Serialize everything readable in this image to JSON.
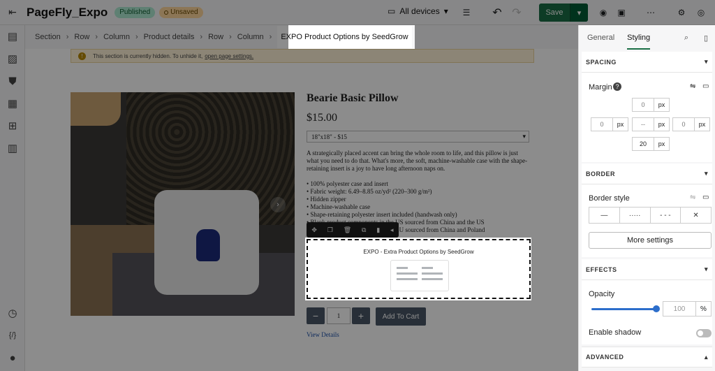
{
  "app": {
    "title": "PageFly_Expo",
    "status_published": "Published",
    "status_unsaved": "Unsaved"
  },
  "toolbar": {
    "devices_label": "All devices",
    "save_label": "Save"
  },
  "breadcrumb": [
    "Section",
    "Row",
    "Column",
    "Product details",
    "Row",
    "Column",
    "EXPO Product Options by SeedGrow"
  ],
  "notice": {
    "text": "This section is currently hidden. To unhide it,",
    "link": "open page settings."
  },
  "product": {
    "title": "Bearie Basic Pillow",
    "price": "$15.00",
    "variant": "18\"x18\" - $15",
    "description": "A strategically placed accent can bring the whole room to life, and this pillow is just what you need to do that. What's more, the soft, machine-washable case with the shape-retaining insert is a joy to have long afternoon naps on.",
    "bullets": [
      "• 100% polyester case and insert",
      "• Fabric weight: 6.49–8.85 oz/yd² (220–300 g/m²)",
      "• Hidden zipper",
      "• Machine-washable case",
      "• Shape-retaining polyester insert included (handwash only)",
      "• Blank product components in the US sourced from China and the US",
      "• Blank product components in the EU sourced from China and Poland"
    ],
    "quantity": "1",
    "add_to_cart": "Add To Cart",
    "view_details": "View Details"
  },
  "expo_block": {
    "title": "EXPO - Extra Product Options by SeedGrow"
  },
  "right_panel": {
    "tab_general": "General",
    "tab_styling": "Styling",
    "spacing": {
      "header": "SPACING",
      "margin_label": "Margin",
      "top": "0",
      "left": "0",
      "center": "--",
      "right": "0",
      "bottom": "20",
      "unit": "px"
    },
    "border": {
      "header": "BORDER",
      "style_label": "Border style",
      "more": "More settings"
    },
    "effects": {
      "header": "EFFECTS",
      "opacity_label": "Opacity",
      "opacity_value": "100",
      "opacity_unit": "%",
      "opacity_level": 1.0,
      "shadow_label": "Enable shadow",
      "shadow_on": false
    },
    "advanced": {
      "header": "ADVANCED"
    }
  },
  "colors": {
    "accent": "#1a6e45",
    "slider": "#2c6ecb",
    "published_bg": "#aee9d1",
    "unsaved_bg": "#ffd79d"
  }
}
